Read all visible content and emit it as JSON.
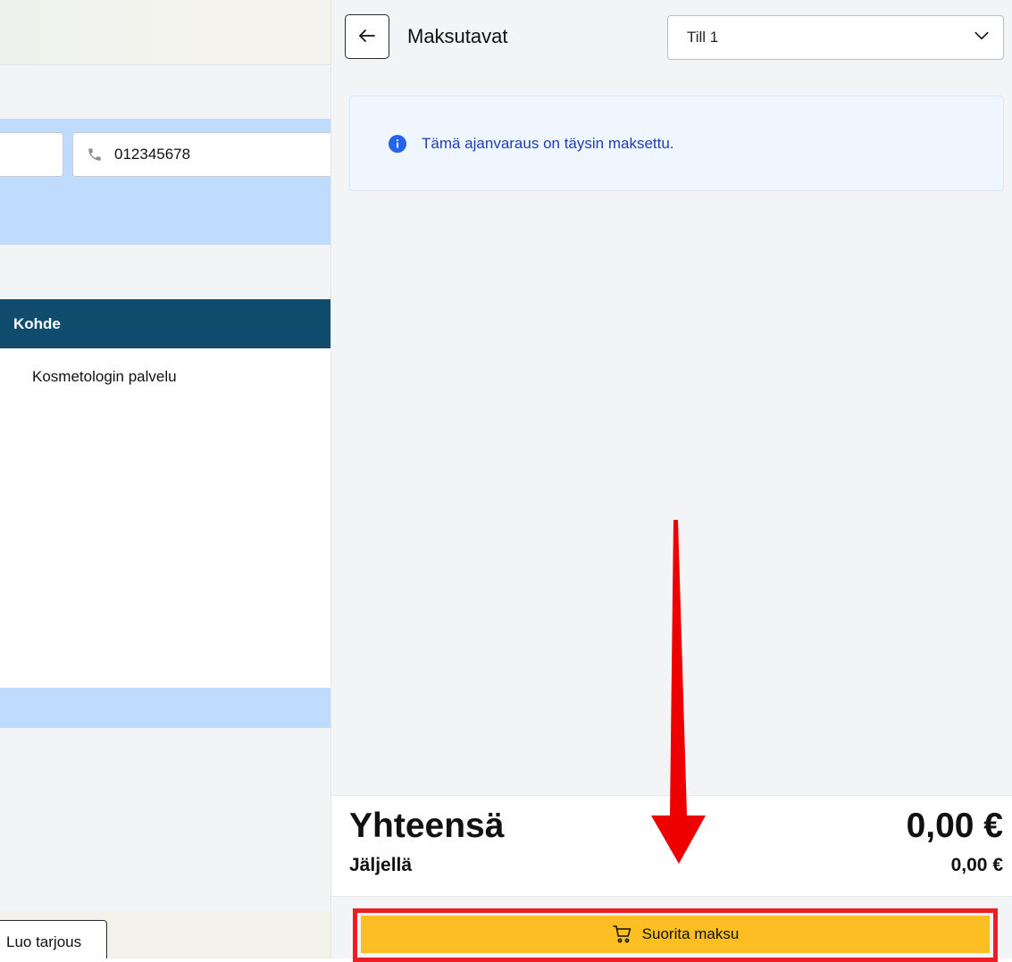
{
  "left_panel": {
    "phone_value": "012345678",
    "table_header": "Kohde",
    "table_rows": [
      "Kosmetologin palvelu"
    ],
    "offer_button": "Luo tarjous"
  },
  "payment_panel": {
    "title": "Maksutavat",
    "till_select": "Till 1",
    "info_message": "Tämä ajanvaraus on täysin maksettu.",
    "total_label": "Yhteensä",
    "total_value": "0,00 €",
    "remaining_label": "Jäljellä",
    "remaining_value": "0,00 €",
    "pay_button": "Suorita maksu"
  },
  "icons": {
    "back": "arrow-left-icon",
    "select": "chevron-down-icon",
    "info": "info-icon",
    "phone": "phone-icon",
    "cart": "cart-icon"
  },
  "colors": {
    "accent_button": "#fbbf24",
    "highlight_frame": "#ef1c24",
    "annotation_arrow": "#ee0000",
    "table_header": "#0f4c6e",
    "info_text": "#1e40af",
    "info_bg": "#eff6ff",
    "band": "#bfdbfe"
  }
}
